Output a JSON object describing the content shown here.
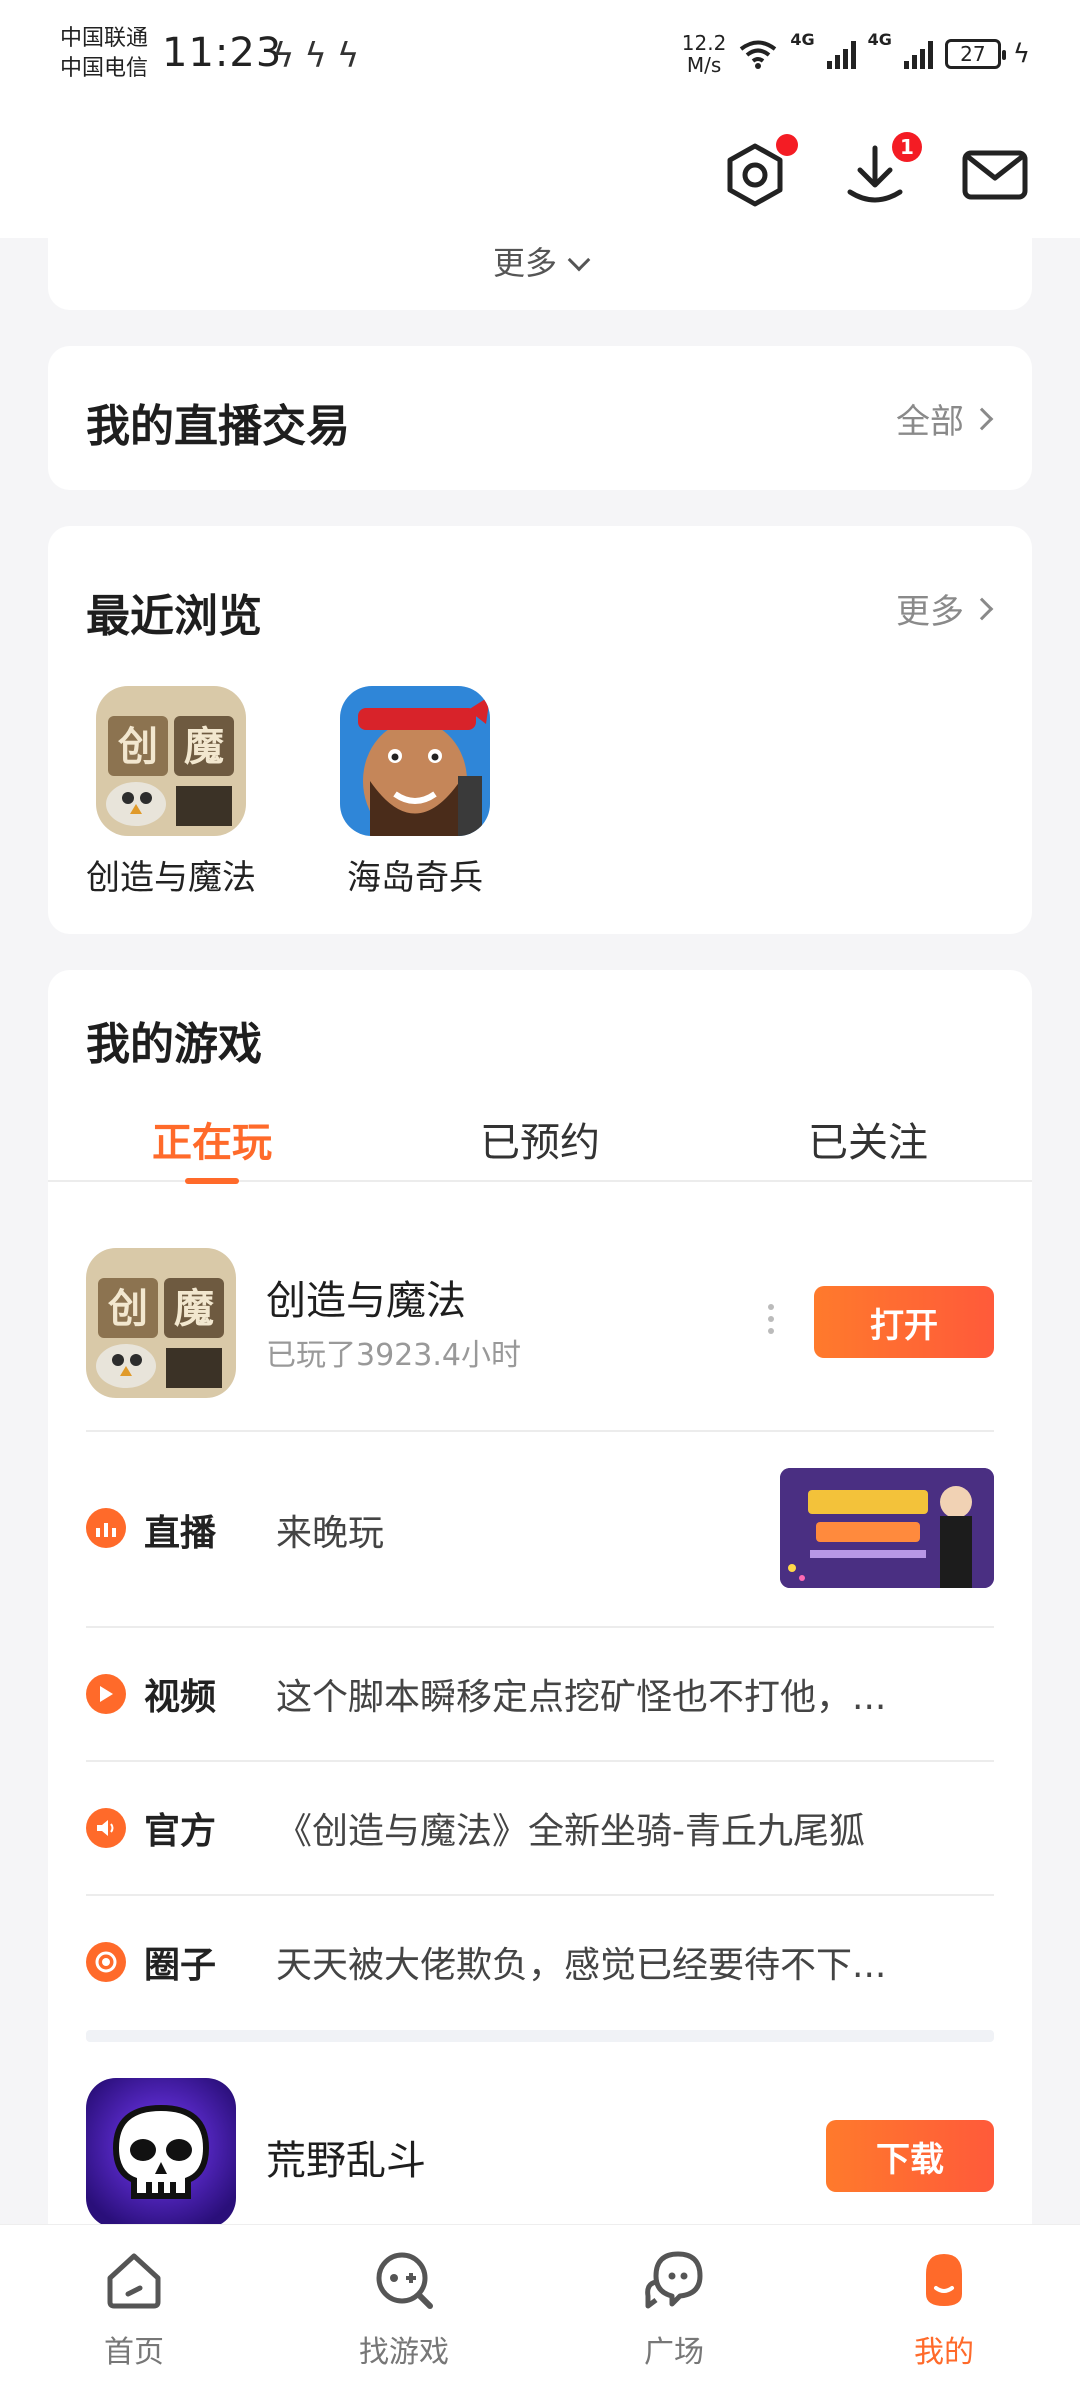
{
  "status_bar": {
    "carrier1": "中国联通",
    "carrier2": "中国电信",
    "time": "11:23",
    "speed_value": "12.2",
    "speed_unit": "M/s",
    "net1": "4G",
    "net2": "4G",
    "battery": "27"
  },
  "header": {
    "download_badge": "1"
  },
  "more_card": {
    "label": "更多"
  },
  "live_trade": {
    "title": "我的直播交易",
    "link": "全部"
  },
  "recent": {
    "title": "最近浏览",
    "link": "更多",
    "items": [
      {
        "name": "创造与魔法"
      },
      {
        "name": "海岛奇兵"
      }
    ]
  },
  "my_games": {
    "title": "我的游戏",
    "tabs": [
      "正在玩",
      "已预约",
      "已关注"
    ],
    "active_tab": "正在玩",
    "games": [
      {
        "name": "创造与魔法",
        "sub": "已玩了3923.4小时",
        "button": "打开"
      },
      {
        "name": "荒野乱斗",
        "sub": "",
        "button": "下载"
      }
    ],
    "feed": [
      {
        "label": "直播",
        "text": "来晚玩",
        "icon": "live-icon"
      },
      {
        "label": "视频",
        "text": "这个脚本瞬移定点挖矿怪也不打他，...",
        "icon": "play-icon"
      },
      {
        "label": "官方",
        "text": "《创造与魔法》全新坐骑-青丘九尾狐",
        "icon": "speaker-icon"
      },
      {
        "label": "圈子",
        "text": "天天被大佬欺负，感觉已经要待不下...",
        "icon": "circle-icon"
      }
    ]
  },
  "bottom_nav": {
    "items": [
      {
        "label": "首页",
        "icon": "home-icon"
      },
      {
        "label": "找游戏",
        "icon": "gamepad-search-icon"
      },
      {
        "label": "广场",
        "icon": "chat-bubbles-icon"
      },
      {
        "label": "我的",
        "icon": "profile-icon"
      }
    ],
    "active": "我的"
  },
  "colors": {
    "accent": "#ff6a2a",
    "badge_red": "#f41c24",
    "background": "#f5f5f7"
  }
}
